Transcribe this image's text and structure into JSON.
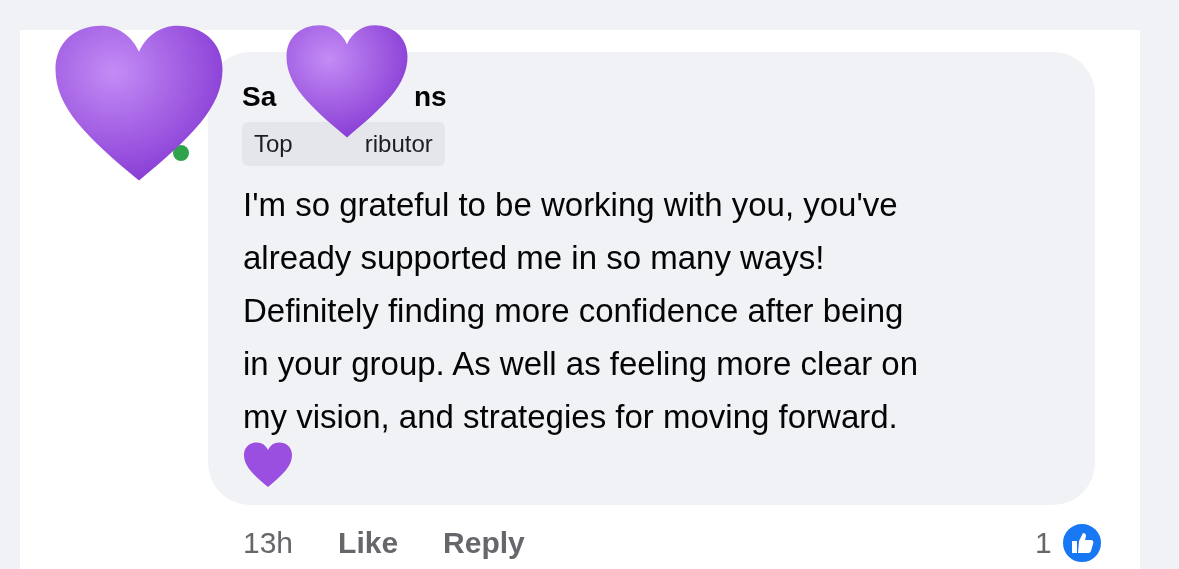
{
  "comment": {
    "author_parts": [
      "Sa",
      "ns"
    ],
    "badge_parts": [
      "Top",
      "ributor"
    ],
    "online": true,
    "text_lines": [
      "I'm so grateful to be working with you, you've",
      "already supported me in so many ways!",
      "Definitely finding more confidence after being",
      "in your group. As well as feeling more clear on",
      "my vision, and strategies for moving forward."
    ],
    "time": "13h",
    "actions": [
      "Like",
      "Reply"
    ],
    "reaction_count": "1"
  }
}
